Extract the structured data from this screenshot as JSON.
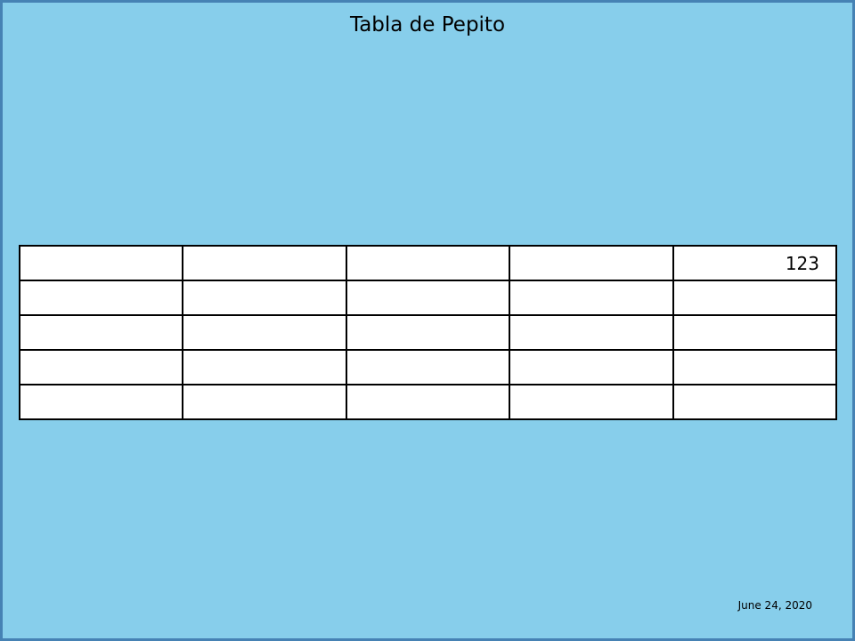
{
  "title": "Tabla de Pepito",
  "table": {
    "rows": [
      [
        "",
        "",
        "",
        "",
        "123"
      ],
      [
        "",
        "",
        "",
        "",
        ""
      ],
      [
        "",
        "",
        "",
        "",
        ""
      ],
      [
        "",
        "",
        "",
        "",
        ""
      ],
      [
        "",
        "",
        "",
        "",
        ""
      ]
    ]
  },
  "footer": {
    "date": "June 24, 2020"
  },
  "colors": {
    "background": "#87ceeb",
    "border": "#4682b4",
    "cell_background": "#ffffff",
    "grid_lines": "#000000"
  }
}
